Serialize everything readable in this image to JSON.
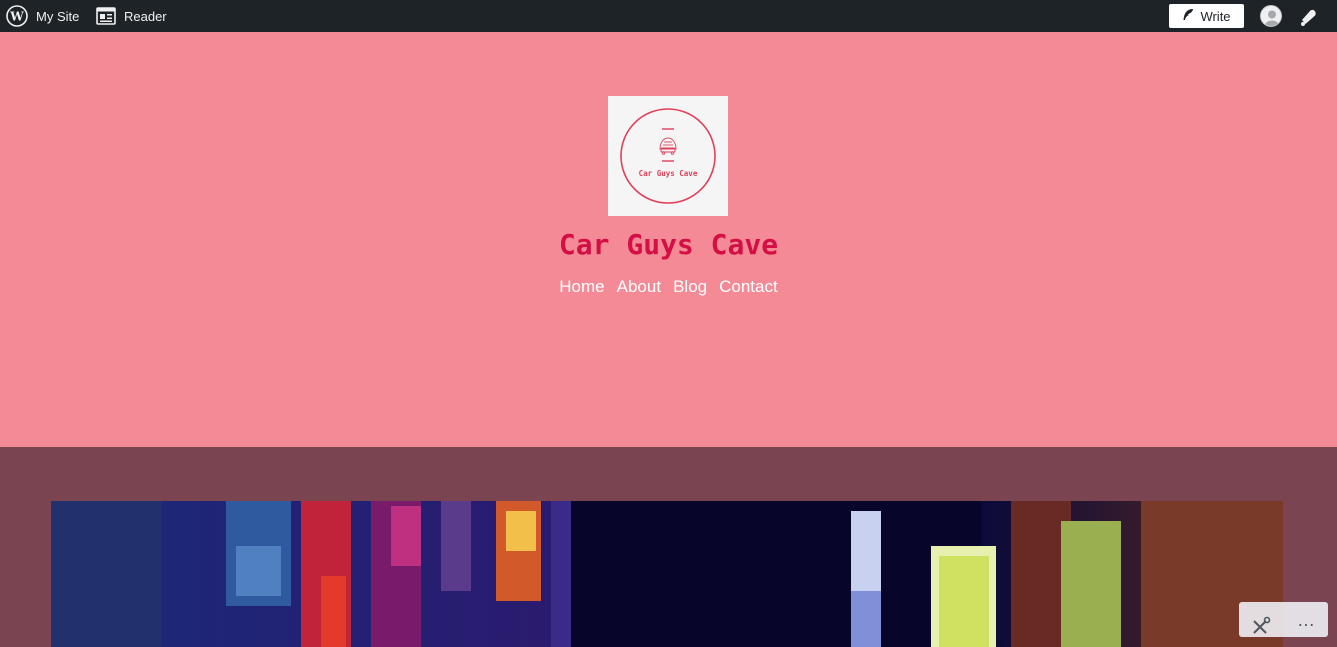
{
  "adminbar": {
    "my_site_label": "My Site",
    "reader_label": "Reader",
    "write_label": "Write",
    "icons": {
      "wordpress": "wordpress-logo-icon",
      "reader": "reader-icon",
      "write": "feather-icon",
      "avatar": "user-avatar-icon",
      "notifications": "bell-icon"
    }
  },
  "header": {
    "logo_text": "Car Guys Cave",
    "site_title": "Car Guys Cave",
    "nav": [
      "Home",
      "About",
      "Blog",
      "Contact"
    ]
  },
  "widget": {
    "more_label": "…",
    "icons": {
      "tools": "tools-icon"
    }
  },
  "colors": {
    "adminbar_bg": "#1d2327",
    "header_bg": "#f48a95",
    "title": "#d40f46",
    "page_bg": "#7a4550"
  }
}
